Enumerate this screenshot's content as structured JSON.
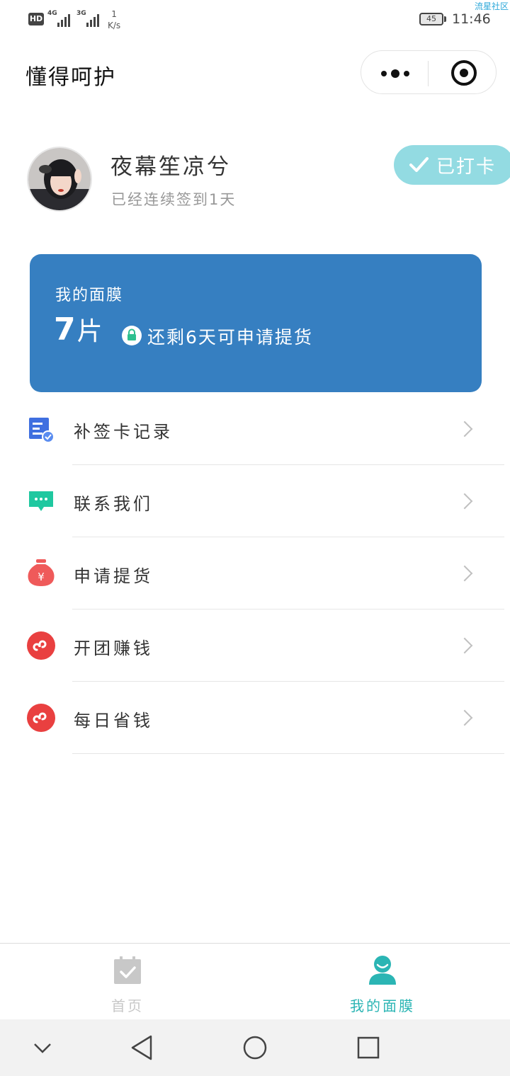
{
  "status_bar": {
    "hd": "HD",
    "net1": "4G",
    "net2": "3G",
    "speed_value": "1",
    "speed_unit": "K/s",
    "battery": "45",
    "time": "11:46",
    "watermark": "流星社区"
  },
  "title_bar": {
    "title": "懂得呵护",
    "more_icon": "more-dots-icon",
    "close_icon": "target-circle-icon"
  },
  "profile": {
    "username": "夜幕笙凉兮",
    "streak": "已经连续签到1天",
    "checkin_label": "已打卡",
    "checkin_color": "#93dbe2"
  },
  "mask_card": {
    "label": "我的面膜",
    "count": "7",
    "unit": "片",
    "note": "还剩6天可申请提货",
    "color": "#367fc1"
  },
  "menu": {
    "items": [
      {
        "label": "补签卡记录",
        "icon": "document-check-icon",
        "color": "#3f6fe0"
      },
      {
        "label": "联系我们",
        "icon": "chat-bubble-icon",
        "color": "#1fc8a0"
      },
      {
        "label": "申请提货",
        "icon": "money-bag-icon",
        "color": "#ef5a5a"
      },
      {
        "label": "开团赚钱",
        "icon": "mini-program-icon",
        "color": "#e94040"
      },
      {
        "label": "每日省钱",
        "icon": "mini-program-icon",
        "color": "#e94040"
      }
    ]
  },
  "tab_bar": {
    "tabs": [
      {
        "label": "首页",
        "icon": "calendar-check-icon",
        "active": false,
        "color": "#c8c8c8"
      },
      {
        "label": "我的面膜",
        "icon": "user-icon",
        "active": true,
        "color": "#2bb5b4"
      }
    ]
  },
  "nav_bar": {
    "icons": [
      "chevron-down-icon",
      "back-triangle-icon",
      "home-circle-icon",
      "recents-square-icon"
    ]
  }
}
